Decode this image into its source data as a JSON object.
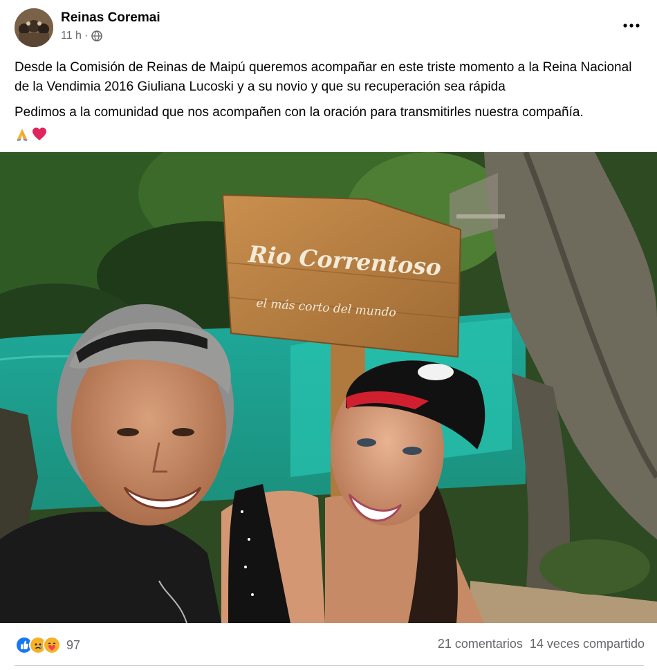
{
  "post": {
    "author": "Reinas Coremai",
    "time": "11 h",
    "separator": "·",
    "privacy_icon": "globe-icon",
    "more_icon": "more-horizontal-icon",
    "paragraphs": [
      "Desde la Comisión de Reinas de Maipú queremos acompañar en este triste momento a la Reina Nacional de la Vendimia 2016 Giuliana Lucoski y a su novio y que su recuperación sea rápida",
      "Pedimos a la comunidad que nos acompañen con la oración para transmitirles nuestra compañía."
    ],
    "emojis": [
      "folded-hands-icon",
      "red-heart-icon"
    ]
  },
  "photo": {
    "sign_title": "Rio Correntoso",
    "sign_subtitle": "el más corto del mundo"
  },
  "footer": {
    "reaction_icons": [
      "like-icon",
      "sad-icon",
      "care-icon"
    ],
    "reaction_count": "97",
    "comments": "21 comentarios",
    "shares": "14 veces compartido"
  },
  "colors": {
    "text": "#050505",
    "secondary": "#65676b",
    "like_blue": "#1877f2",
    "reaction_yellow": "#f7b125",
    "divider": "#ced0d4"
  }
}
